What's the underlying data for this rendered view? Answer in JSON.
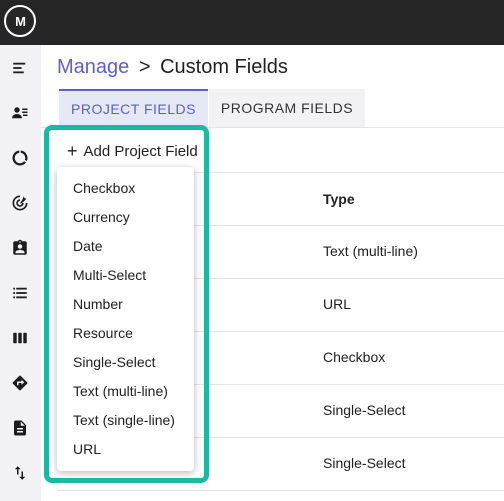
{
  "app": {
    "logo_text": "M"
  },
  "sidebar": {
    "icons": [
      "menu-icon",
      "people-list-icon",
      "donut-chart-icon",
      "target-icon",
      "clipboard-user-icon",
      "bulleted-list-icon",
      "columns-icon",
      "directions-icon",
      "document-icon",
      "sort-arrows-icon"
    ]
  },
  "breadcrumb": {
    "parent": "Manage",
    "separator": ">",
    "current": "Custom Fields"
  },
  "tabs": [
    {
      "label": "PROJECT FIELDS",
      "active": true
    },
    {
      "label": "PROGRAM FIELDS",
      "active": false
    }
  ],
  "toolbar": {
    "add_icon": "+",
    "add_label": "Add Project Field"
  },
  "table": {
    "columns": [
      "Type"
    ],
    "rows": [
      {
        "type": "Text (multi-line)"
      },
      {
        "type": "URL"
      },
      {
        "type": "Checkbox"
      },
      {
        "type": "Single-Select"
      },
      {
        "type": "Single-Select"
      }
    ]
  },
  "dropdown": {
    "items": [
      "Checkbox",
      "Currency",
      "Date",
      "Multi-Select",
      "Number",
      "Resource",
      "Single-Select",
      "Text (multi-line)",
      "Text (single-line)",
      "URL"
    ]
  },
  "colors": {
    "accent": "#5c5fd3",
    "highlight": "#1cb8a6",
    "topbar": "#262626",
    "sidebar": "#f2f2f5"
  }
}
